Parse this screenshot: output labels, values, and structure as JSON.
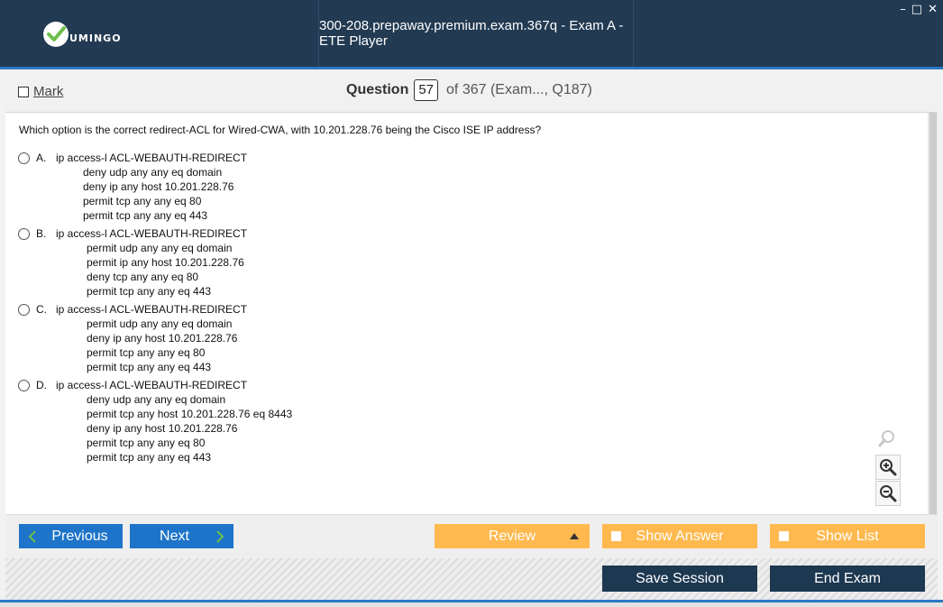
{
  "window": {
    "title": "300-208.prepaway.premium.exam.367q - Exam A - ETE Player",
    "logo_text": "UMINGO",
    "controls": [
      "–",
      "□",
      "✕"
    ]
  },
  "header": {
    "mark_label": "Mark",
    "question_label": "Question",
    "question_number": "57",
    "question_of": "of 367 (Exam..., Q187)"
  },
  "question": {
    "text": "Which option is the correct redirect-ACL for Wired-CWA, with 10.201.228.76 being the Cisco ISE IP address?",
    "options": [
      {
        "letter": "A.",
        "first_line": "ip access-l ACL-WEBAUTH-REDIRECT",
        "lines": [
          "deny udp any any eq domain",
          "deny ip any host 10.201.228.76",
          "permit tcp any any eq 80",
          "permit tcp any any eq 443"
        ]
      },
      {
        "letter": "B.",
        "first_line": "ip access-l ACL-WEBAUTH-REDIRECT",
        "lines": [
          "permit udp any any eq domain",
          "permit ip any host 10.201.228.76",
          "deny tcp any any eq 80",
          "permit tcp any any eq 443"
        ]
      },
      {
        "letter": "C.",
        "first_line": "ip access-l ACL-WEBAUTH-REDIRECT",
        "lines": [
          "permit udp any any eq domain",
          "deny ip any host 10.201.228.76",
          "permit tcp any any eq 80",
          "permit tcp any any eq 443"
        ]
      },
      {
        "letter": "D.",
        "first_line": "ip access-l ACL-WEBAUTH-REDIRECT",
        "lines": [
          "deny udp any any eq domain",
          "permit tcp any host 10.201.228.76 eq 8443",
          "deny ip any host 10.201.228.76",
          "permit tcp any any eq 80",
          "permit tcp any any eq 443"
        ]
      }
    ]
  },
  "nav": {
    "previous_label": "Previous",
    "next_label": "Next",
    "review_label": "Review",
    "show_answer_label": "Show Answer",
    "show_list_label": "Show List"
  },
  "footer": {
    "save_session_label": "Save Session",
    "end_exam_label": "End Exam"
  },
  "colors": {
    "titlebar": "#223a52",
    "accent_blue": "#1e74c8",
    "accent_orange": "#ffb94f",
    "dark_button": "#1d3851"
  },
  "icons": [
    "check-logo-icon",
    "chevron-left-icon",
    "chevron-right-icon",
    "triangle-up-icon",
    "zoom-icon",
    "zoom-in-icon",
    "zoom-out-icon"
  ]
}
